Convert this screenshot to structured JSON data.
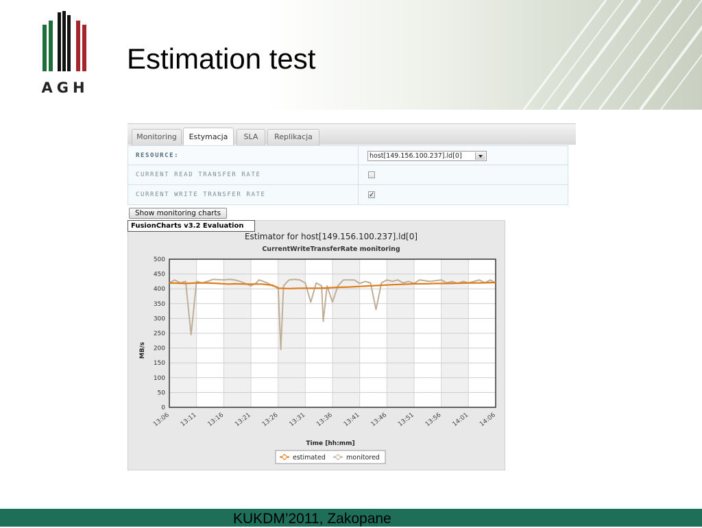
{
  "slide": {
    "title": "Estimation test",
    "logo_text": "AGH",
    "footer": "KUKDM’2011, Zakopane"
  },
  "tabs": [
    {
      "label": "Monitoring",
      "active": false
    },
    {
      "label": "Estymacja",
      "active": true
    },
    {
      "label": "SLA",
      "active": false
    },
    {
      "label": "Replikacja",
      "active": false
    }
  ],
  "form": {
    "resource_label": "RESOURCE:",
    "resource_value": "host[149.156.100.237].ld[0]",
    "read_rate_label": "CURRENT READ TRANSFER RATE",
    "read_rate_checked": false,
    "write_rate_label": "CURRENT WRITE TRANSFER RATE",
    "write_rate_checked": true,
    "show_button": "Show monitoring charts"
  },
  "fusion_badge": "FusionCharts v3.2 Evaluation",
  "colors": {
    "estimated": "#e07b1a",
    "monitored": "#bfae98",
    "footer_bg": "#1e6e58",
    "logo_green": "#1e6e3c",
    "logo_red": "#a4262c"
  },
  "chart_data": {
    "type": "line",
    "title": "Estimator for host[149.156.100.237].ld[0]",
    "subtitle": "CurrentWriteTransferRate monitoring",
    "xlabel": "Time [hh:mm]",
    "ylabel": "MB/s",
    "ylim": [
      0,
      500
    ],
    "yticks": [
      0,
      50,
      100,
      150,
      200,
      250,
      300,
      350,
      400,
      450,
      500
    ],
    "xticks": [
      "13:06",
      "13:11",
      "13:16",
      "13:21",
      "13:26",
      "13:31",
      "13:36",
      "13:41",
      "13:46",
      "13:51",
      "13:56",
      "14:01",
      "14:06"
    ],
    "x_minutes_range": [
      0,
      60
    ],
    "grid": true,
    "legend_position": "bottom",
    "series": [
      {
        "name": "estimated",
        "points": [
          [
            0,
            420
          ],
          [
            3,
            418
          ],
          [
            5,
            420
          ],
          [
            7,
            420
          ],
          [
            9,
            418
          ],
          [
            11,
            416
          ],
          [
            12,
            417
          ],
          [
            14,
            416
          ],
          [
            17,
            416
          ],
          [
            19,
            412
          ],
          [
            20,
            402
          ],
          [
            22,
            401
          ],
          [
            24,
            402
          ],
          [
            27,
            402
          ],
          [
            29,
            403
          ],
          [
            31,
            405
          ],
          [
            33,
            406
          ],
          [
            35,
            408
          ],
          [
            37,
            410
          ],
          [
            39,
            412
          ],
          [
            41,
            414
          ],
          [
            43,
            415
          ],
          [
            45,
            417
          ],
          [
            47,
            417
          ],
          [
            49,
            418
          ],
          [
            51,
            418
          ],
          [
            53,
            419
          ],
          [
            55,
            420
          ],
          [
            57,
            420
          ],
          [
            59,
            421
          ],
          [
            60,
            421
          ]
        ]
      },
      {
        "name": "monitored",
        "points": [
          [
            0,
            420
          ],
          [
            1,
            430
          ],
          [
            2,
            420
          ],
          [
            3,
            425
          ],
          [
            4,
            245
          ],
          [
            5,
            425
          ],
          [
            6,
            420
          ],
          [
            7,
            425
          ],
          [
            8,
            432
          ],
          [
            10,
            430
          ],
          [
            11,
            432
          ],
          [
            12,
            430
          ],
          [
            13,
            425
          ],
          [
            14,
            418
          ],
          [
            15,
            410
          ],
          [
            16,
            420
          ],
          [
            16.5,
            430
          ],
          [
            18,
            420
          ],
          [
            19,
            410
          ],
          [
            20,
            405
          ],
          [
            20.5,
            195
          ],
          [
            21,
            410
          ],
          [
            22,
            430
          ],
          [
            23,
            432
          ],
          [
            24,
            430
          ],
          [
            25,
            420
          ],
          [
            26,
            355
          ],
          [
            27,
            420
          ],
          [
            28,
            410
          ],
          [
            28.3,
            290
          ],
          [
            29,
            410
          ],
          [
            30,
            355
          ],
          [
            31,
            410
          ],
          [
            32,
            430
          ],
          [
            34,
            430
          ],
          [
            35,
            418
          ],
          [
            36,
            425
          ],
          [
            37,
            420
          ],
          [
            38,
            330
          ],
          [
            39,
            420
          ],
          [
            40,
            430
          ],
          [
            41,
            425
          ],
          [
            42,
            430
          ],
          [
            43,
            420
          ],
          [
            44,
            425
          ],
          [
            45,
            418
          ],
          [
            46,
            430
          ],
          [
            48,
            425
          ],
          [
            50,
            430
          ],
          [
            51,
            420
          ],
          [
            52,
            425
          ],
          [
            53,
            418
          ],
          [
            54,
            425
          ],
          [
            55,
            420
          ],
          [
            57,
            430
          ],
          [
            58,
            420
          ],
          [
            59,
            430
          ],
          [
            60,
            420
          ]
        ]
      }
    ]
  }
}
